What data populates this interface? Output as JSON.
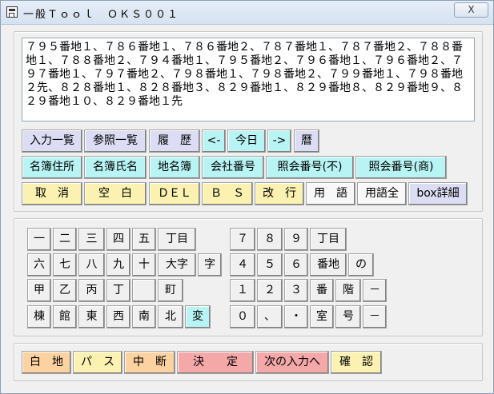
{
  "window": {
    "title": "一般Ｔｏｏｌ　ＯＫＳ００１",
    "close_label": "X"
  },
  "memo": {
    "text": "７９５番地１、７８６番地１、７８６番地２、７８７番地１、７８７番地２、７８８番地１、７８８番地２、７９４番地１、７９５番地２、７９６番地１、７９６番地２、７９７番地１、７９７番地２、７９８番地１、７９８番地２、７９９番地１、７９８番地２先、８２８番地１、８２８番地３、８２９番地１、８２９番地８、８２９番地９、８２９番地１０、８２９番地１先"
  },
  "toolbar": {
    "row1": [
      "入力一覧",
      "参照一覧",
      "履　歴",
      "<-",
      "今日",
      "->",
      "暦"
    ],
    "row2": [
      "名簿住所",
      "名簿氏名",
      "地名簿",
      "会社番号",
      "照会番号(不)",
      "照会番号(商)"
    ],
    "row3": [
      "取　消",
      "空　白",
      "ＤＥＬ",
      "Ｂ　Ｓ",
      "改　行",
      "用　語",
      "用語全",
      "box詳細"
    ]
  },
  "keypad_left": {
    "row1": [
      "一",
      "二",
      "三",
      "四",
      "五",
      "丁目"
    ],
    "row2": [
      "六",
      "七",
      "八",
      "九",
      "十",
      "大字",
      "字"
    ],
    "row3": [
      "甲",
      "乙",
      "丙",
      "丁",
      "",
      "町"
    ],
    "row4": [
      "棟",
      "館",
      "東",
      "西",
      "南",
      "北",
      "変"
    ]
  },
  "keypad_right": {
    "row1": [
      "７",
      "８",
      "９",
      "丁目"
    ],
    "row2": [
      "４",
      "５",
      "６",
      "番地",
      "の"
    ],
    "row3": [
      "１",
      "２",
      "３",
      "番",
      "階",
      "－"
    ],
    "row4": [
      "０",
      "、",
      "・",
      "室",
      "号",
      "－"
    ]
  },
  "bottom_bar": [
    "白　地",
    "パ　ス",
    "中　断",
    "決　　定",
    "次の入力へ",
    "確　認"
  ],
  "colors": {
    "lavender": "#dcdcf4",
    "cyan": "#b8f4f4",
    "yellow": "#fbf1b0",
    "peach": "#fbd2a0",
    "pink": "#f4a8a8"
  }
}
